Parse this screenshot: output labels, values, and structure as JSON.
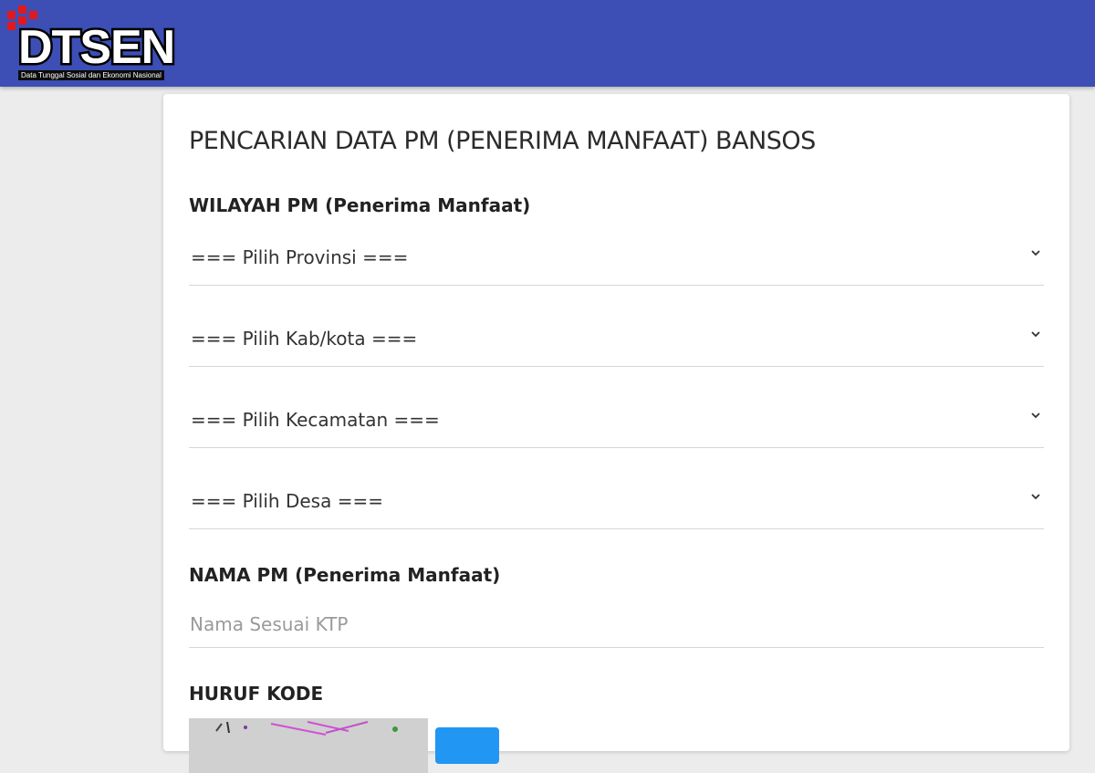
{
  "header": {
    "logo_text": "DTSEN",
    "logo_subtitle": "Data Tunggal Sosial dan Ekonomi Nasional",
    "colors": {
      "bar": "#3d4eb5",
      "logo_red": "#e0191e"
    }
  },
  "form": {
    "title": "PENCARIAN DATA PM (PENERIMA MANFAAT) BANSOS",
    "wilayah_label": "WILAYAH PM (Penerima Manfaat)",
    "selects": [
      {
        "value": "=== Pilih Provinsi ===",
        "icon": "chevron-down-icon"
      },
      {
        "value": "=== Pilih Kab/kota ===",
        "icon": "chevron-down-icon"
      },
      {
        "value": "=== Pilih Kecamatan ===",
        "icon": "chevron-down-icon"
      },
      {
        "value": "=== Pilih Desa ===",
        "icon": "chevron-down-icon"
      }
    ],
    "nama_label": "NAMA PM (Penerima Manfaat)",
    "nama_input": {
      "value": "",
      "placeholder": "Nama Sesuai KTP"
    },
    "kode_label": "HURUF KODE",
    "accent": "#2196f3"
  }
}
